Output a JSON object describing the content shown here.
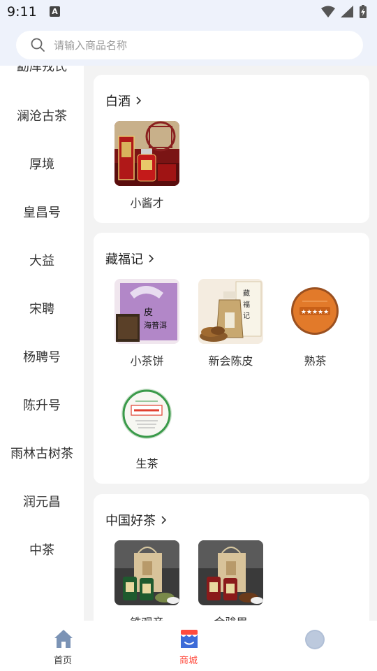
{
  "status_bar": {
    "time": "9:11",
    "badge": "A"
  },
  "search": {
    "placeholder": "请输入商品名称"
  },
  "sidebar": {
    "items": [
      {
        "label": "勐库戎氏"
      },
      {
        "label": "澜沧古茶"
      },
      {
        "label": "厚境"
      },
      {
        "label": "皇昌号"
      },
      {
        "label": "大益"
      },
      {
        "label": "宋聘"
      },
      {
        "label": "杨聘号"
      },
      {
        "label": "陈升号"
      },
      {
        "label": "雨林古树茶"
      },
      {
        "label": "润元昌"
      },
      {
        "label": "中茶"
      }
    ]
  },
  "sections": [
    {
      "title": "白酒",
      "products": [
        {
          "name": "小酱才",
          "icon": "baijiu-box-image"
        }
      ]
    },
    {
      "title": "藏福记",
      "products": [
        {
          "name": "小茶饼",
          "icon": "puer-box-image",
          "image_text": "皮\n海普洱"
        },
        {
          "name": "新会陈皮",
          "icon": "tangerine-peel-jar-image"
        },
        {
          "name": "熟茶",
          "icon": "ripe-tea-cake-image"
        },
        {
          "name": "生茶",
          "icon": "raw-tea-cake-image"
        }
      ]
    },
    {
      "title": "中国好茶",
      "products": [
        {
          "name": "铁观音",
          "icon": "tieguanyin-gift-set-image"
        },
        {
          "name": "金骏眉",
          "icon": "jinjunmei-gift-set-image"
        }
      ]
    }
  ],
  "tabbar": {
    "tabs": [
      {
        "label": "首页",
        "icon": "home-icon"
      },
      {
        "label": "商城",
        "icon": "store-icon",
        "active": true
      },
      {
        "label": "",
        "icon": "profile-icon"
      }
    ],
    "active_color": "#ff4b3e",
    "inactive_color": "#333333"
  }
}
